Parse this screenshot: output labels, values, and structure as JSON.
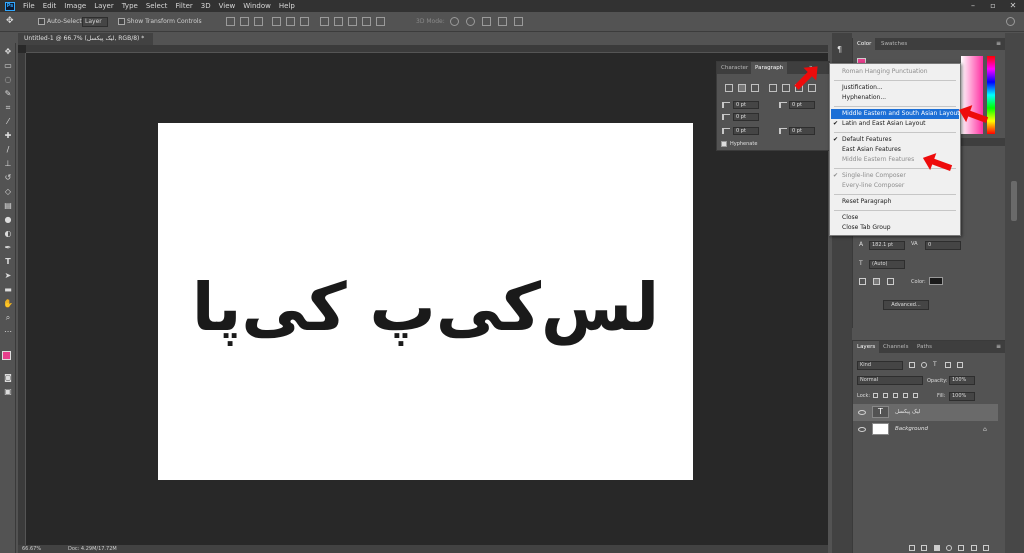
{
  "app": {
    "logo_text": "Ps",
    "menu": [
      "File",
      "Edit",
      "Image",
      "Layer",
      "Type",
      "Select",
      "Filter",
      "3D",
      "View",
      "Window",
      "Help"
    ]
  },
  "options_bar": {
    "auto_select_label": "Auto-Select:",
    "layer_dropdown": "Layer",
    "show_transform_label": "Show Transform Controls",
    "mode_3d_label": "3D Mode:"
  },
  "document": {
    "tab_title": "Untitled-1 @ 66.7% (لیک پیکسل, RGB/8) *",
    "canvas_text": "لس‌کی‌پ کی‌پا",
    "zoom": "66.67%",
    "doc_info": "Doc: 4.29M/17.72M"
  },
  "paragraph_panel": {
    "tabs": [
      "Character",
      "Paragraph"
    ],
    "fields": [
      "0 pt",
      "0 pt",
      "0 pt",
      "0 pt",
      "0 pt"
    ],
    "hyphenate_label": "Hyphenate"
  },
  "flyout_menu": {
    "items": [
      {
        "label": "Roman Hanging Punctuation",
        "state": "disabled",
        "checked": false
      },
      {
        "label": "Justification...",
        "state": "normal",
        "checked": false
      },
      {
        "label": "Hyphenation...",
        "state": "normal",
        "checked": false
      },
      {
        "label": "Middle Eastern and South Asian Layout",
        "state": "highlight",
        "checked": false
      },
      {
        "label": "Latin and East Asian Layout",
        "state": "normal",
        "checked": true
      },
      {
        "label": "Default Features",
        "state": "normal",
        "checked": true
      },
      {
        "label": "East Asian Features",
        "state": "normal",
        "checked": false
      },
      {
        "label": "Middle Eastern Features",
        "state": "disabled",
        "checked": false
      },
      {
        "label": "Single-line Composer",
        "state": "disabled",
        "checked": true
      },
      {
        "label": "Every-line Composer",
        "state": "disabled",
        "checked": false
      },
      {
        "label": "Reset Paragraph",
        "state": "normal",
        "checked": false
      },
      {
        "label": "Close",
        "state": "normal",
        "checked": false
      },
      {
        "label": "Close Tab Group",
        "state": "normal",
        "checked": false
      }
    ]
  },
  "color_panel": {
    "tabs": [
      "Color",
      "Swatches"
    ]
  },
  "character_panel": {
    "leading": "182.1 pt",
    "tracking": "0",
    "auto": "(Auto)",
    "color_label": "Color:",
    "advanced_button": "Advanced..."
  },
  "layers_panel": {
    "tabs": [
      "Layers",
      "Channels",
      "Paths"
    ],
    "kind_filter": "Kind",
    "blend_mode": "Normal",
    "opacity_label": "Opacity:",
    "opacity_value": "100%",
    "lock_label": "Lock:",
    "fill_label": "Fill:",
    "fill_value": "100%",
    "layers": [
      {
        "name": "لیک پیکسل",
        "type": "text"
      },
      {
        "name": "Background",
        "type": "background"
      }
    ]
  },
  "colors": {
    "highlight": "#1c6fd6",
    "arrow": "#ee0b0b",
    "foreground_swatch": "#e83e8c"
  }
}
